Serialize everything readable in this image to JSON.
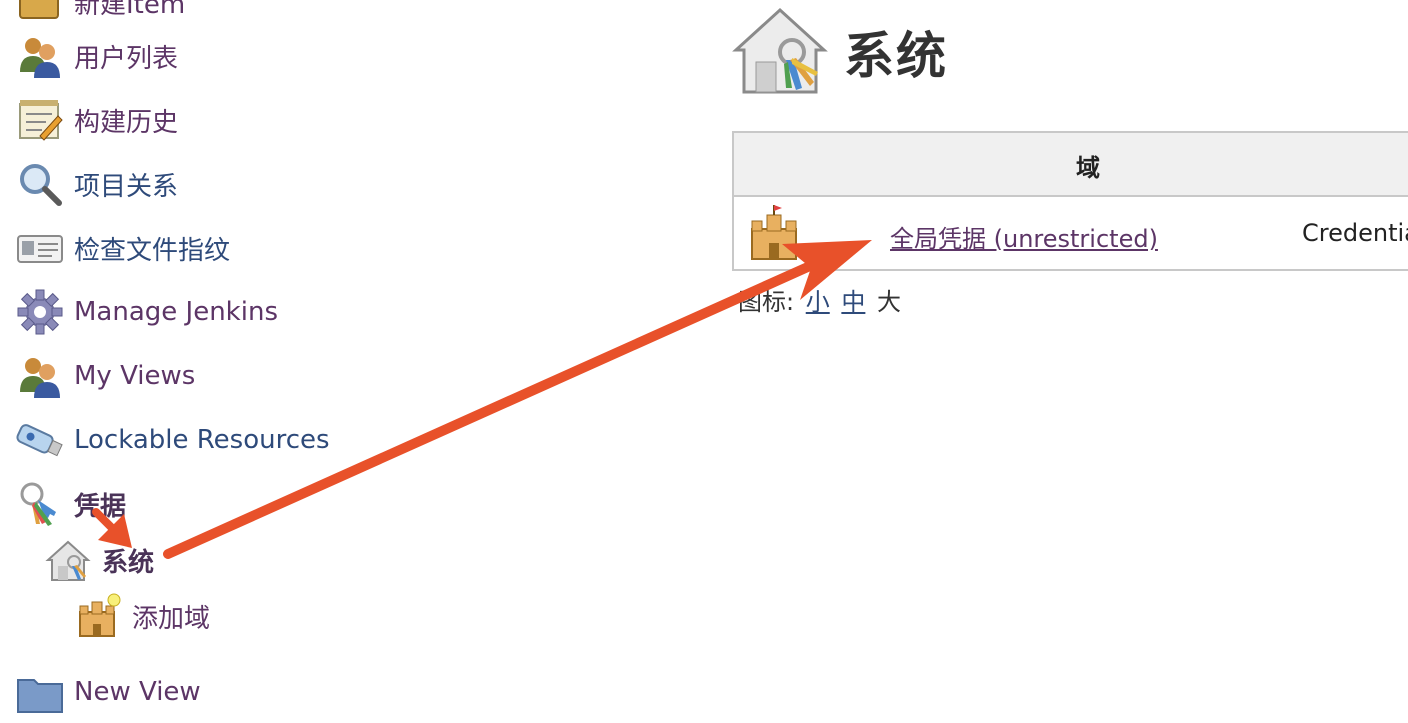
{
  "sidebar": {
    "items": [
      {
        "label": "新建Item",
        "icon": "new-item-icon"
      },
      {
        "label": "用户列表",
        "icon": "users-icon"
      },
      {
        "label": "构建历史",
        "icon": "notepad-icon"
      },
      {
        "label": "项目关系",
        "icon": "magnifier-icon"
      },
      {
        "label": "检查文件指纹",
        "icon": "fingerprint-card-icon"
      },
      {
        "label": "Manage Jenkins",
        "icon": "gear-icon"
      },
      {
        "label": "My Views",
        "icon": "users-icon"
      },
      {
        "label": "Lockable Resources",
        "icon": "usb-drive-icon"
      },
      {
        "label": "凭据",
        "icon": "keys-icon"
      },
      {
        "label": "系统",
        "icon": "house-keys-icon"
      },
      {
        "label": "添加域",
        "icon": "castle-add-icon"
      },
      {
        "label": "New View",
        "icon": "folder-icon"
      }
    ]
  },
  "main": {
    "title": "系统",
    "table": {
      "header": "域",
      "rows": [
        {
          "name": "全局凭据 (unrestricted)",
          "provider": "Credentia"
        }
      ]
    },
    "icon_size": {
      "label": "图标:",
      "small": "小",
      "medium": "中",
      "large": "大"
    }
  },
  "colors": {
    "arrow": "#e8512a",
    "link_visited": "#5c3566",
    "link": "#2e4a7a"
  }
}
